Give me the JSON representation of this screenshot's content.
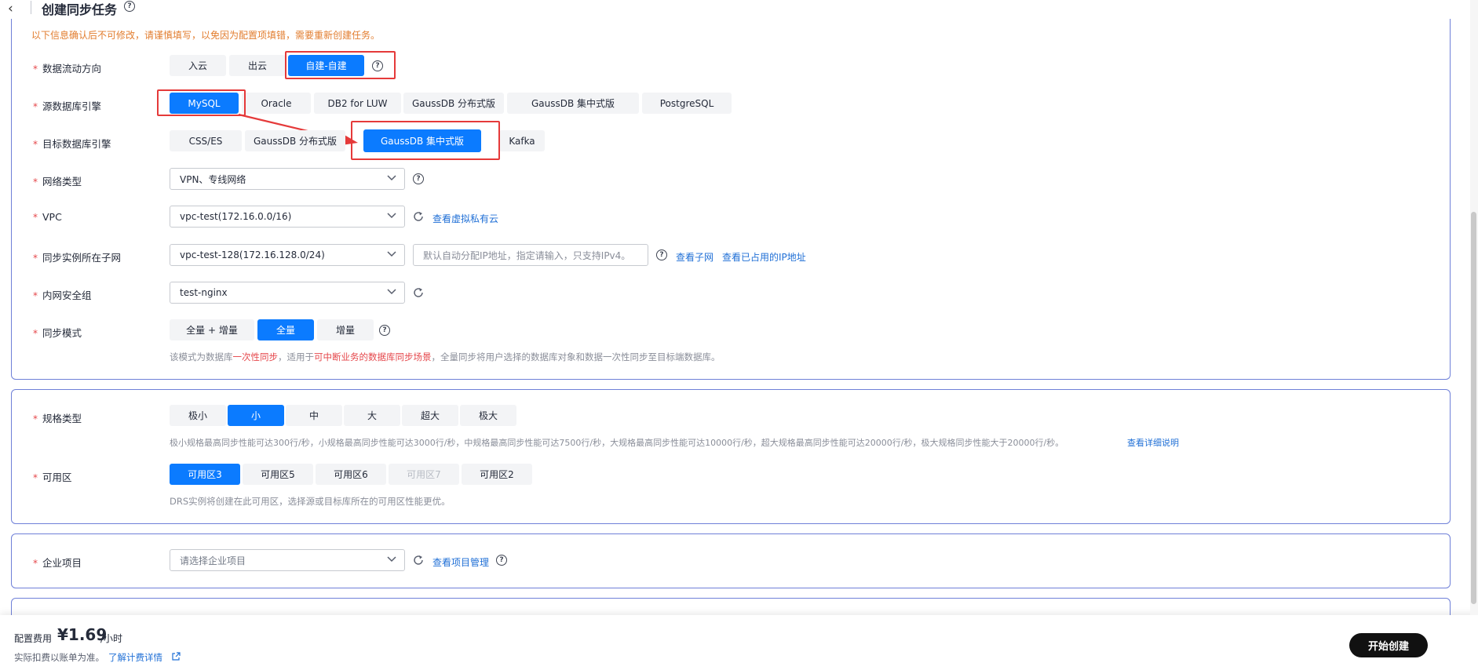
{
  "header": {
    "back_icon": "chevron-left-icon",
    "title": "创建同步任务"
  },
  "warning": "以下信息确认后不可修改，请谨慎填写，以免因为配置项填错，需要重新创建任务。",
  "flow": {
    "label": "数据流动方向",
    "options": [
      "入云",
      "出云",
      "自建-自建"
    ],
    "selected": "自建-自建"
  },
  "source_engine": {
    "label": "源数据库引擎",
    "options": [
      "MySQL",
      "Oracle",
      "DB2 for LUW",
      "GaussDB 分布式版",
      "GaussDB 集中式版",
      "PostgreSQL"
    ],
    "selected": "MySQL"
  },
  "target_engine": {
    "label": "目标数据库引擎",
    "options": [
      "CSS/ES",
      "GaussDB 分布式版",
      "GaussDB 集中式版",
      "Kafka"
    ],
    "selected": "GaussDB 集中式版"
  },
  "network": {
    "label": "网络类型",
    "value": "VPN、专线网络"
  },
  "vpc": {
    "label": "VPC",
    "value": "vpc-test(172.16.0.0/16)",
    "link": "查看虚拟私有云"
  },
  "subnet": {
    "label": "同步实例所在子网",
    "value": "vpc-test-128(172.16.128.0/24)",
    "ip_placeholder": "默认自动分配IP地址，指定请输入，只支持IPv4。",
    "link1": "查看子网",
    "link2": "查看已占用的IP地址"
  },
  "security_group": {
    "label": "内网安全组",
    "value": "test-nginx"
  },
  "sync_mode": {
    "label": "同步模式",
    "options": [
      "全量 + 增量",
      "全量",
      "增量"
    ],
    "selected": "全量",
    "desc_1": "该模式为数据库",
    "desc_hl1": "一次性同步",
    "desc_2": "，适用于",
    "desc_hl2": "可中断业务的数据库同步场景",
    "desc_3": "，全量同步将用户选择的数据库对象和数据一次性同步至目标端数据库。"
  },
  "spec": {
    "label": "规格类型",
    "options": [
      "极小",
      "小",
      "中",
      "大",
      "超大",
      "极大"
    ],
    "selected": "小",
    "desc": "极小规格最高同步性能可达300行/秒，小规格最高同步性能可达3000行/秒，中规格最高同步性能可达7500行/秒，大规格最高同步性能可达10000行/秒，超大规格最高同步性能可达20000行/秒，极大规格同步性能大于20000行/秒。",
    "link": "查看详细说明"
  },
  "az": {
    "label": "可用区",
    "options": [
      "可用区3",
      "可用区5",
      "可用区6",
      "可用区7",
      "可用区2"
    ],
    "selected": "可用区3",
    "disabled": "可用区7",
    "desc": "DRS实例将创建在此可用区，选择源或目标库所在的可用区性能更优。"
  },
  "enterprise": {
    "label": "企业项目",
    "placeholder": "请选择企业项目",
    "link": "查看项目管理"
  },
  "footer": {
    "fee_label": "配置费用",
    "fee_value": "¥1.69",
    "fee_unit": "/小时",
    "note": "实际扣费以账单为准。",
    "link": "了解计费详情",
    "button": "开始创建"
  },
  "colors": {
    "primary": "#0b7bff",
    "required": "#e5474b",
    "warning": "#e27d2f",
    "link": "#1f6fd6",
    "highlight_box": "#e53a3a"
  }
}
